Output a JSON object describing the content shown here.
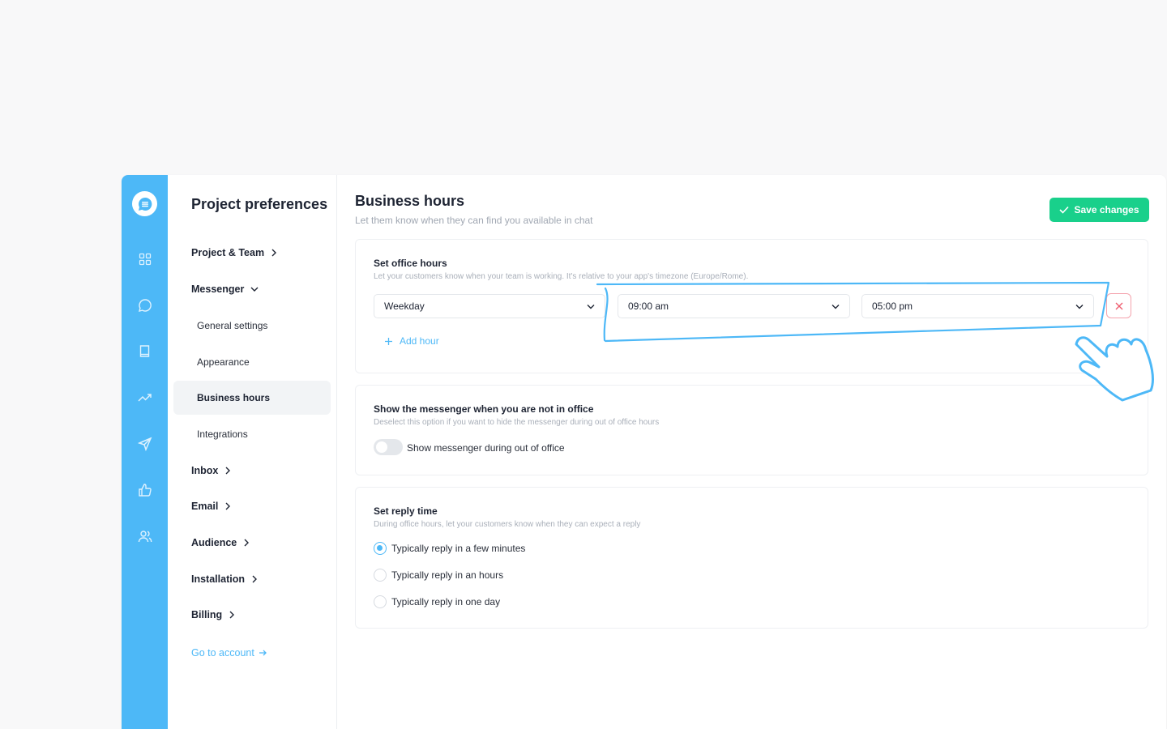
{
  "sidebar_nav": {
    "title": "Project preferences",
    "items": [
      {
        "label": "Project & Team",
        "icon": "chevron-right-icon"
      },
      {
        "label": "Messenger",
        "icon": "chevron-down-icon"
      },
      {
        "label": "Inbox",
        "icon": "chevron-right-icon"
      },
      {
        "label": "Email",
        "icon": "chevron-right-icon"
      },
      {
        "label": "Audience",
        "icon": "chevron-right-icon"
      },
      {
        "label": "Installation",
        "icon": "chevron-right-icon"
      },
      {
        "label": "Billing",
        "icon": "chevron-right-icon"
      }
    ],
    "messenger_subitems": [
      {
        "label": "General settings"
      },
      {
        "label": "Appearance"
      },
      {
        "label": "Business hours",
        "active": true
      },
      {
        "label": "Integrations"
      }
    ],
    "account_link": "Go to account"
  },
  "rail": {
    "icons": [
      "chat-logo-icon",
      "dashboard-icon",
      "conversations-icon",
      "knowledge-base-icon",
      "reports-icon",
      "campaigns-icon",
      "feedback-icon",
      "contacts-icon"
    ]
  },
  "header": {
    "title": "Business hours",
    "subtitle": "Let them know when they can find you available in chat",
    "save_label": "Save changes"
  },
  "office_hours": {
    "title": "Set office hours",
    "description": "Let your customers know when your team is working. It's relative to your app's timezone (Europe/Rome).",
    "day_value": "Weekday",
    "start_value": "09:00 am",
    "end_value": "05:00 pm",
    "add_label": "Add hour"
  },
  "out_of_office": {
    "title": "Show the messenger when you are not in office",
    "description": "Deselect this option if you want to hide the messenger during out of office hours",
    "toggle_label": "Show messenger during out of office",
    "toggle_on": false
  },
  "reply_time": {
    "title": "Set reply time",
    "description": "During office hours, let your customers know when they can expect a reply",
    "options": [
      {
        "label": "Typically reply in a few minutes",
        "selected": true
      },
      {
        "label": "Typically reply in an hours",
        "selected": false
      },
      {
        "label": "Typically reply in one day",
        "selected": false
      }
    ]
  },
  "colors": {
    "brand": "#4db8f7",
    "save": "#19d08b",
    "danger": "#f4a3ad"
  }
}
